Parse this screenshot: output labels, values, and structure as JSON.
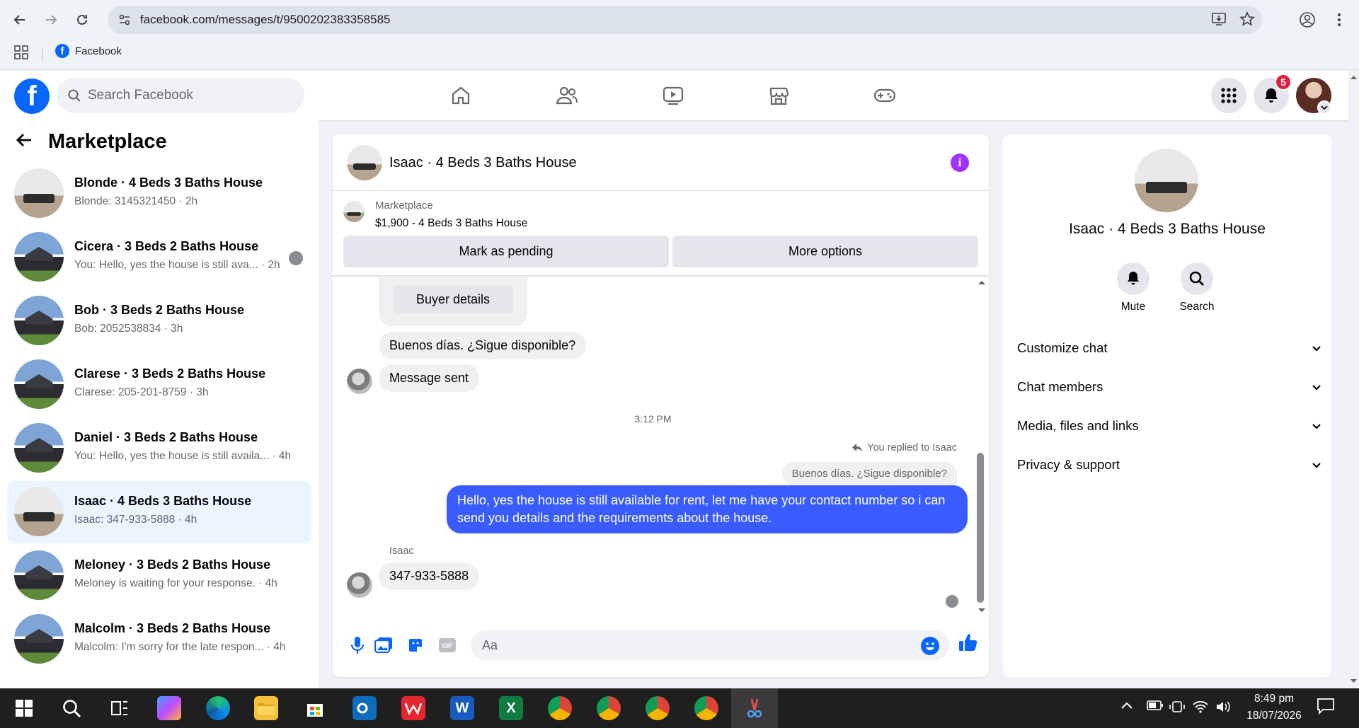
{
  "browser": {
    "url": "facebook.com/messages/t/9500202383358585",
    "bookmark_label": "Facebook"
  },
  "header": {
    "search_placeholder": "Search Facebook",
    "notification_count": "5",
    "nav_icons": [
      "home-icon",
      "friends-icon",
      "video-icon",
      "marketplace-icon",
      "gaming-icon"
    ]
  },
  "sidebar": {
    "title": "Marketplace",
    "conversations": [
      {
        "title": "Blonde · 4 Beds 3 Baths House",
        "preview": "Blonde: 3145321450 · 2h",
        "thumb": "room"
      },
      {
        "title": "Cicera · 3 Beds 2 Baths House",
        "preview": "You: Hello, yes the house is still ava... · 2h",
        "thumb": "house"
      },
      {
        "title": "Bob · 3 Beds 2 Baths House",
        "preview": "Bob: 2052538834 · 3h",
        "thumb": "house"
      },
      {
        "title": "Clarese · 3 Beds 2 Baths House",
        "preview": "Clarese: 205-201-8759 · 3h",
        "thumb": "house"
      },
      {
        "title": "Daniel · 3 Beds 2 Baths House",
        "preview": "You: Hello, yes the house is still availa... · 4h",
        "thumb": "house"
      },
      {
        "title": "Isaac · 4 Beds 3 Baths House",
        "preview": "Isaac: 347-933-5888 · 4h",
        "thumb": "room",
        "active": true
      },
      {
        "title": "Meloney · 3 Beds 2 Baths House",
        "preview": "Meloney is waiting for your response. · 4h",
        "thumb": "house"
      },
      {
        "title": "Malcolm · 3 Beds 2 Baths House",
        "preview": "Malcolm: I'm sorry for the late respon... · 4h",
        "thumb": "house"
      }
    ]
  },
  "chat": {
    "title": "Isaac · 4 Beds 3 Baths House",
    "listing_source": "Marketplace",
    "listing_price": "$1,900 - 4 Beds 3 Baths House",
    "mark_pending_label": "Mark as pending",
    "more_options_label": "More options",
    "buyer_details_label": "Buyer details",
    "msg_incoming_1": "Buenos días. ¿Sigue disponible?",
    "msg_system": "Message sent",
    "timestamp": "3:12 PM",
    "replied_label": "You replied to Isaac",
    "quoted_text": "Buenos días. ¿Sigue disponible?",
    "msg_outgoing": "Hello, yes the house is still available for rent, let me have your contact number so i can send you details and the requirements about the house.",
    "sender_name": "Isaac",
    "msg_incoming_2": "347-933-5888",
    "composer_placeholder": "Aa"
  },
  "info_panel": {
    "title": "Isaac · 4 Beds 3 Baths House",
    "mute_label": "Mute",
    "search_label": "Search",
    "sections": [
      "Customize chat",
      "Chat members",
      "Media, files and links",
      "Privacy & support"
    ]
  },
  "taskbar": {
    "time": "8:49 pm",
    "date": "18/07/2026"
  },
  "colors": {
    "fb_blue": "#0866ff",
    "outgoing_bubble": "#3a5cff",
    "info_purple": "#a033ff",
    "badge_red": "#e41e3f"
  }
}
